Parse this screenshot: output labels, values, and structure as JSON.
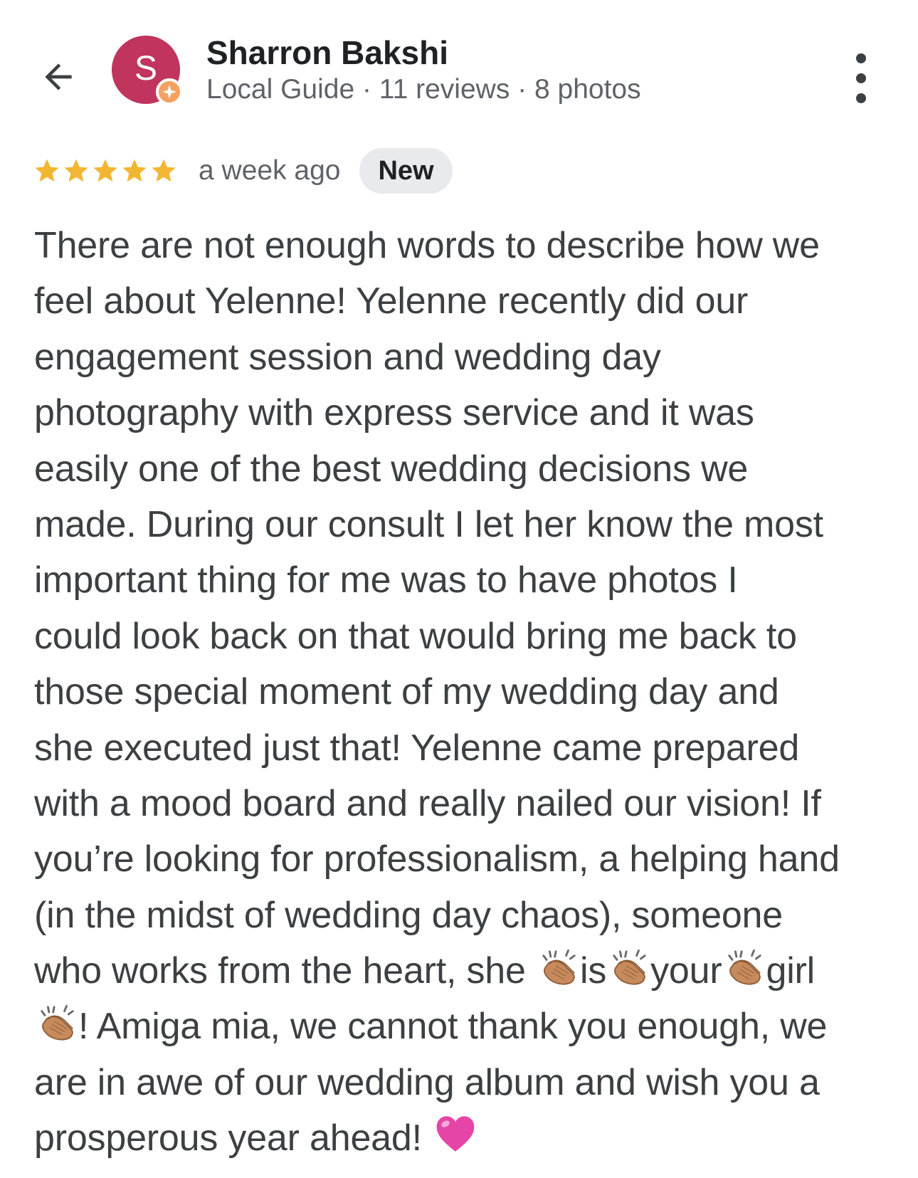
{
  "header": {
    "back_icon": "arrow-back-icon",
    "avatar": {
      "letter": "S",
      "background_color": "#C0345E",
      "badge_icon": "local-guide-star-icon",
      "badge_color": "#F4A261"
    },
    "user_name": "Sharron Bakshi",
    "user_meta": "Local Guide · 11 reviews · 8 photos",
    "more_icon": "more-vertical-icon"
  },
  "review": {
    "rating": 5,
    "rating_max": 5,
    "star_color": "#F2B632",
    "date": "a week ago",
    "badge_label": "New",
    "badge_bg": "#E8EAED",
    "text_lines": [
      [
        {
          "t": "There are not enough words to describe how we"
        }
      ],
      [
        {
          "t": "feel about Yelenne! Yelenne recently did our"
        }
      ],
      [
        {
          "t": "engagement session and wedding day"
        }
      ],
      [
        {
          "t": "photography with express service and it was"
        }
      ],
      [
        {
          "t": "easily one of the best wedding decisions we"
        }
      ],
      [
        {
          "t": "made. During our consult I let her know the most"
        }
      ],
      [
        {
          "t": "important thing for me was to have photos I"
        }
      ],
      [
        {
          "t": "could look back on that would bring me back to"
        }
      ],
      [
        {
          "t": "those special moment of my wedding day and"
        }
      ],
      [
        {
          "t": "she executed just that! Yelenne came prepared"
        }
      ],
      [
        {
          "t": "with a mood board and really nailed our vision! If"
        }
      ],
      [
        {
          "t": "you’re looking for professionalism, a helping hand"
        }
      ],
      [
        {
          "t": "(in the midst of wedding day chaos), someone"
        }
      ],
      [
        {
          "t": "who works from the heart, she "
        },
        {
          "e": "clapping-hands-emoji"
        },
        {
          "t": "is"
        },
        {
          "e": "clapping-hands-emoji"
        },
        {
          "t": "your"
        },
        {
          "e": "clapping-hands-emoji"
        },
        {
          "t": "girl"
        }
      ],
      [
        {
          "e": "clapping-hands-emoji"
        },
        {
          "t": "! Amiga mia, we cannot thank you enough, we"
        }
      ],
      [
        {
          "t": "are in awe of our wedding album and wish you a"
        }
      ],
      [
        {
          "t": "prosperous year ahead! "
        },
        {
          "e": "pink-heart-emoji"
        }
      ]
    ],
    "emoji_colors": {
      "clap_skin": "#C68A5C",
      "heart": "#E545A6"
    }
  }
}
